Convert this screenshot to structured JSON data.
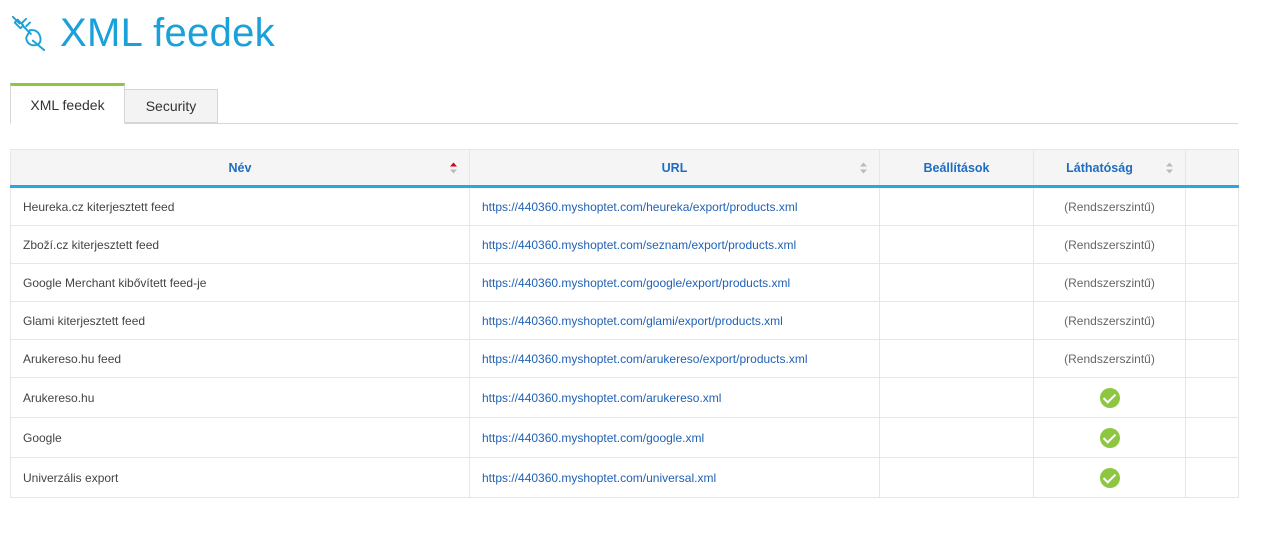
{
  "header": {
    "title": "XML feedek",
    "icon": "plug-icon"
  },
  "tabs": [
    {
      "label": "XML feedek",
      "active": true
    },
    {
      "label": "Security",
      "active": false
    }
  ],
  "table": {
    "columns": [
      {
        "label": "Név",
        "sort": "asc"
      },
      {
        "label": "URL",
        "sort": "none"
      },
      {
        "label": "Beállítások",
        "sort": null
      },
      {
        "label": "Láthatóság",
        "sort": "none"
      },
      {
        "label": "",
        "sort": null
      }
    ],
    "rows": [
      {
        "name": "Heureka.cz kiterjesztett feed",
        "url": "https://440360.myshoptet.com/heureka/export/products.xml",
        "visibility": "(Rendszerszintű)"
      },
      {
        "name": "Zboží.cz kiterjesztett feed",
        "url": "https://440360.myshoptet.com/seznam/export/products.xml",
        "visibility": "(Rendszerszintű)"
      },
      {
        "name": "Google Merchant kibővített feed-je",
        "url": "https://440360.myshoptet.com/google/export/products.xml",
        "visibility": "(Rendszerszintű)"
      },
      {
        "name": "Glami kiterjesztett feed",
        "url": "https://440360.myshoptet.com/glami/export/products.xml",
        "visibility": "(Rendszerszintű)"
      },
      {
        "name": "Arukereso.hu feed",
        "url": "https://440360.myshoptet.com/arukereso/export/products.xml",
        "visibility": "(Rendszerszintű)"
      },
      {
        "name": "Arukereso.hu",
        "url": "https://440360.myshoptet.com/arukereso.xml",
        "visibility": "check-icon"
      },
      {
        "name": "Google",
        "url": "https://440360.myshoptet.com/google.xml",
        "visibility": "check-icon"
      },
      {
        "name": "Univerzális export",
        "url": "https://440360.myshoptet.com/universal.xml",
        "visibility": "check-icon"
      }
    ]
  },
  "colors": {
    "title": "#1ba1d9",
    "tab_active_border": "#8dc63f",
    "header_underline": "#27a8e0",
    "link": "#2162b5",
    "check": "#8dc63f"
  }
}
